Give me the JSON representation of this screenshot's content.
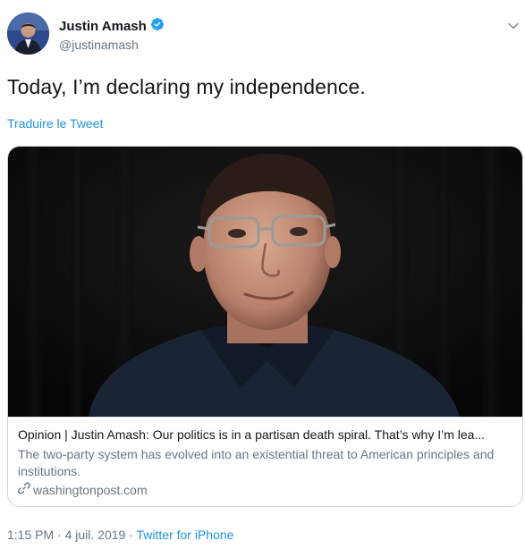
{
  "author": {
    "name": "Justin Amash",
    "handle": "@justinamash",
    "verified": true
  },
  "tweet": {
    "text": "Today, I’m declaring my independence.",
    "translate_label": "Traduire le Tweet"
  },
  "card": {
    "title": "Opinion | Justin Amash: Our politics is in a partisan death spiral. That’s why I’m lea...",
    "description": "The two-party system has evolved into an existential threat to American principles and institutions.",
    "domain": "washingtonpost.com"
  },
  "meta": {
    "time": "1:15 PM",
    "date": "4 juil. 2019",
    "separator": "·",
    "source": "Twitter for iPhone"
  },
  "colors": {
    "link": "#1b95e0",
    "secondary_text": "#657786",
    "border": "#ccd6dd",
    "verified_badge": "#1da1f2"
  },
  "icons": [
    "avatar",
    "verified-badge-icon",
    "chevron-down-icon",
    "link-icon"
  ]
}
